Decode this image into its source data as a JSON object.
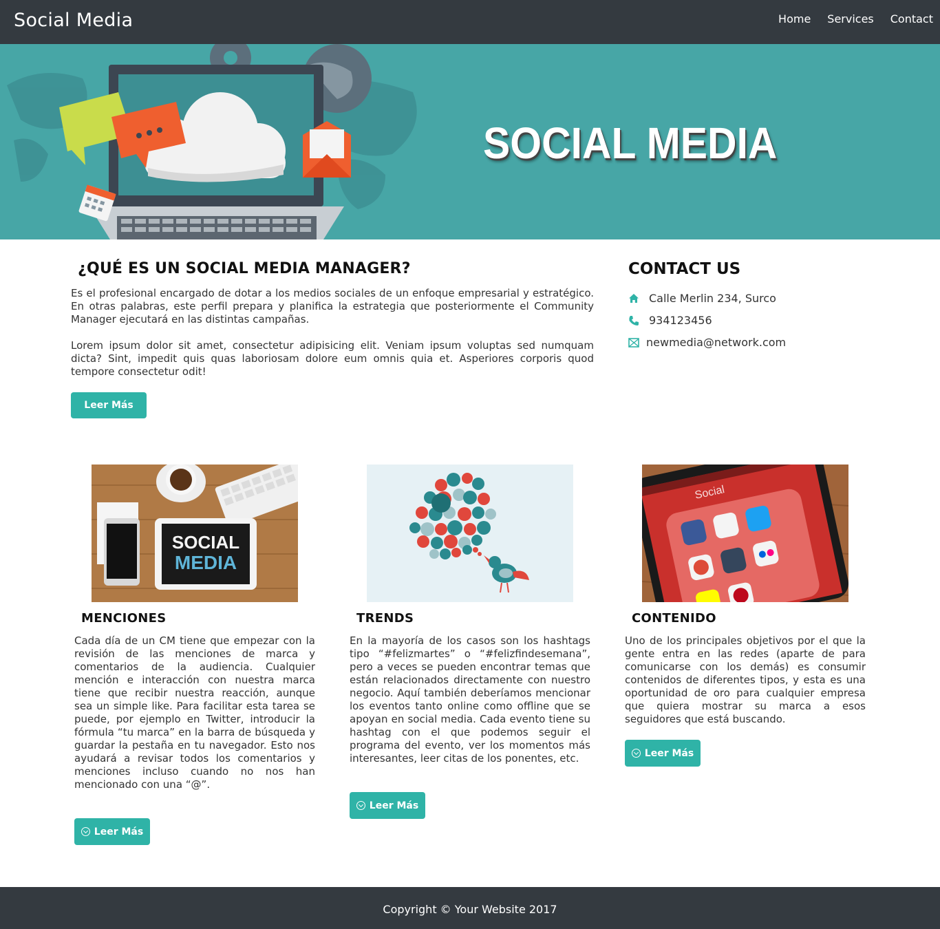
{
  "navbar": {
    "brand": "Social Media",
    "links": [
      "Home",
      "Services",
      "Contact"
    ]
  },
  "hero": {
    "title": "SOCIAL MEDIA",
    "background_color": "#47a6a6"
  },
  "about": {
    "title": "¿QUÉ ES UN SOCIAL MEDIA MANAGER?",
    "paragraph1": "Es el profesional encargado de dotar a los medios sociales de un enfoque empresarial y estratégico. En otras palabras, este perfil prepara y planifica la estrategia que posteriormente el Community Manager ejecutará en las distintas campañas.",
    "paragraph2": "Lorem ipsum dolor sit amet, consectetur adipisicing elit. Veniam ipsum voluptas sed numquam dicta? Sint, impedit quis quas laboriosam dolore eum omnis quia et. Asperiores corporis quod tempore consectetur odit!",
    "button_label": "Leer Más"
  },
  "contact": {
    "title": "CONTACT US",
    "address": "Calle Merlin 234, Surco",
    "phone": "934123456",
    "email": "newmedia@network.com",
    "icons": [
      "home-icon",
      "phone-icon",
      "envelope-icon"
    ],
    "accent_color": "#2fb3a7"
  },
  "cards": [
    {
      "title": "MENCIONES",
      "image_text": [
        "SOCIAL",
        "MEDIA"
      ],
      "text": "Cada día de un CM tiene que empezar con la revisión de las menciones de marca y comentarios de la audiencia. Cualquier mención e interacción con nuestra marca tiene que recibir nuestra reacción, aunque sea un simple like. Para facilitar esta tarea se puede, por ejemplo en Twitter, introducir la fórmula “tu marca” en la barra de búsqueda y guardar la pestaña en tu navegador. Esto nos ayudará a revisar todos los comentarios y menciones incluso cuando no nos han mencionado con una “@”.",
      "button_label": "Leer Más"
    },
    {
      "title": "TRENDS",
      "text": "En la mayoría de los casos son los hashtags tipo “#felizmartes” o “#felizfindesemana”, pero a veces se pueden encontrar temas que están relacionados directamente con nuestro negocio. Aquí también deberíamos mencionar los eventos tanto online como offline que se apoyan en social media. Cada evento tiene su hashtag con el que podemos seguir el programa del evento, ver los momentos más interesantes, leer citas de los ponentes, etc.",
      "button_label": "Leer Más"
    },
    {
      "title": "CONTENIDO",
      "image_text": [
        "Social"
      ],
      "text": "Uno de los principales objetivos por el que la gente entra en las redes (aparte de para comunicarse con los demás) es consumir contenidos de diferentes tipos, y esta es una oportunidad de oro para cualquier empresa que quiera mostrar su marca a esos seguidores que está buscando.",
      "button_label": "Leer Más"
    }
  ],
  "footer": {
    "text": "Copyright © Your Website 2017"
  },
  "colors": {
    "dark": "#343a40",
    "accent": "#2fb3a7",
    "hero": "#47a6a6"
  }
}
